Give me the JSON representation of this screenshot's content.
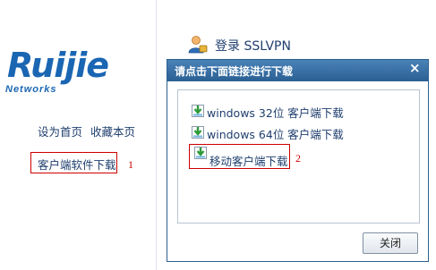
{
  "brand": {
    "logo_main": "Ruijie",
    "logo_sub": "Networks",
    "color": "#1a66b3"
  },
  "left_links": {
    "set_home": "设为首页",
    "bookmark": "收藏本页",
    "client_download": "客户端软件下载"
  },
  "annotations": {
    "marker1": "1",
    "marker2": "2"
  },
  "header": {
    "login_text": "登录 SSLVPN",
    "icon": "user-icon"
  },
  "dialog": {
    "title": "请点击下面链接进行下载",
    "close_symbol": "×",
    "items": [
      {
        "label": "windows 32位 客户端下载",
        "icon": "download-icon"
      },
      {
        "label": "windows 64位 客户端下载",
        "icon": "download-icon"
      },
      {
        "label": "移动客户端下载",
        "icon": "download-icon"
      }
    ],
    "close_button": "关闭"
  },
  "colors": {
    "title_bar": "#2a5f93",
    "highlight": "#cc0000",
    "link": "#1f3f6e"
  }
}
